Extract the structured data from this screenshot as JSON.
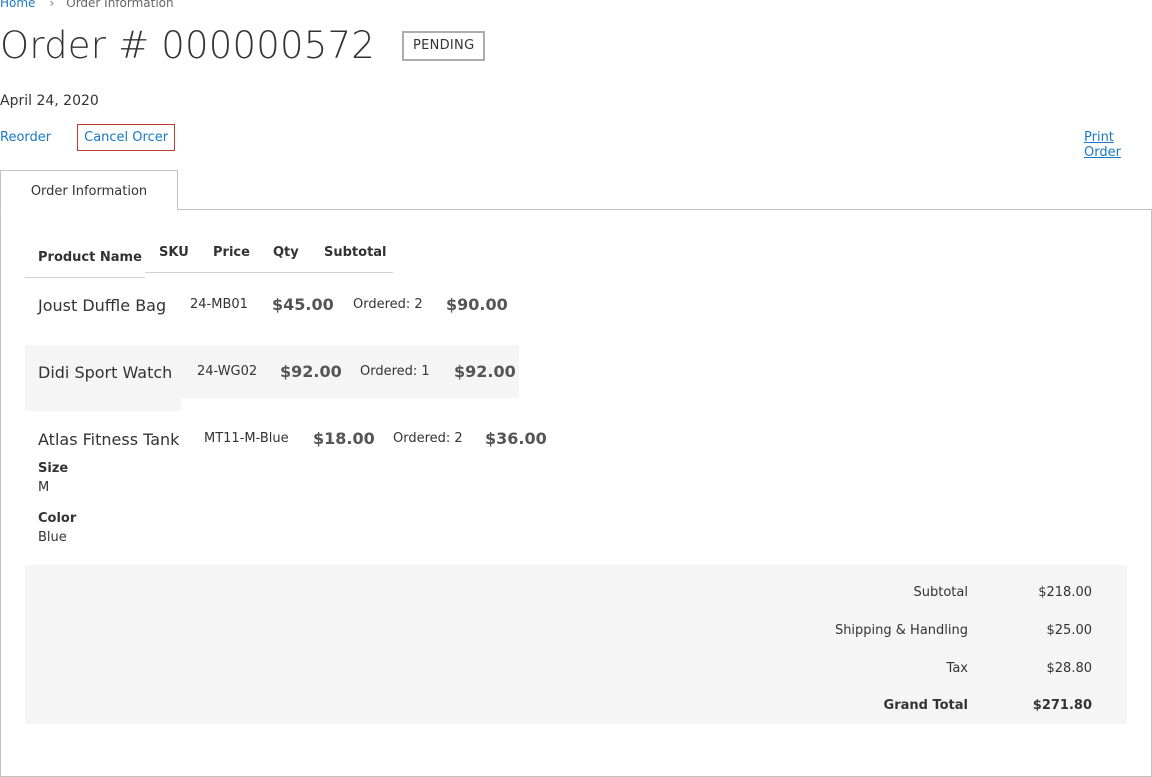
{
  "breadcrumb": {
    "home": "Home",
    "current": "Order Information"
  },
  "order": {
    "title": "Order # 000000572",
    "status": "PENDING",
    "date": "April 24, 2020"
  },
  "actions": {
    "reorder": "Reorder",
    "cancel": "Cancel Orcer",
    "print": "Print Order"
  },
  "tab": {
    "label": "Order Information"
  },
  "table": {
    "headers": {
      "product": "Product Name",
      "sku": "SKU",
      "price": "Price",
      "qty": "Qty",
      "subtotal": "Subtotal"
    },
    "rows": [
      {
        "name": "Joust Duffle Bag",
        "sku": "24-MB01",
        "price": "$45.00",
        "qty": "Ordered: 2",
        "subtotal": "$90.00"
      },
      {
        "name": "Didi Sport Watch",
        "sku": "24-WG02",
        "price": "$92.00",
        "qty": "Ordered: 1",
        "subtotal": "$92.00"
      },
      {
        "name": "Atlas Fitness Tank",
        "sku": "MT11-M-Blue",
        "price": "$18.00",
        "qty": "Ordered: 2",
        "subtotal": "$36.00",
        "options": [
          {
            "label": "Size",
            "value": "M"
          },
          {
            "label": "Color",
            "value": "Blue"
          }
        ]
      }
    ]
  },
  "totals": {
    "subtotal_label": "Subtotal",
    "subtotal": "$218.00",
    "shipping_label": "Shipping & Handling",
    "shipping": "$25.00",
    "tax_label": "Tax",
    "tax": "$28.80",
    "grand_label": "Grand Total",
    "grand": "$271.80"
  },
  "colors": {
    "link": "#1979c3",
    "cancel_outline": "#c0392b",
    "row_highlight": "#f5f5f5"
  }
}
